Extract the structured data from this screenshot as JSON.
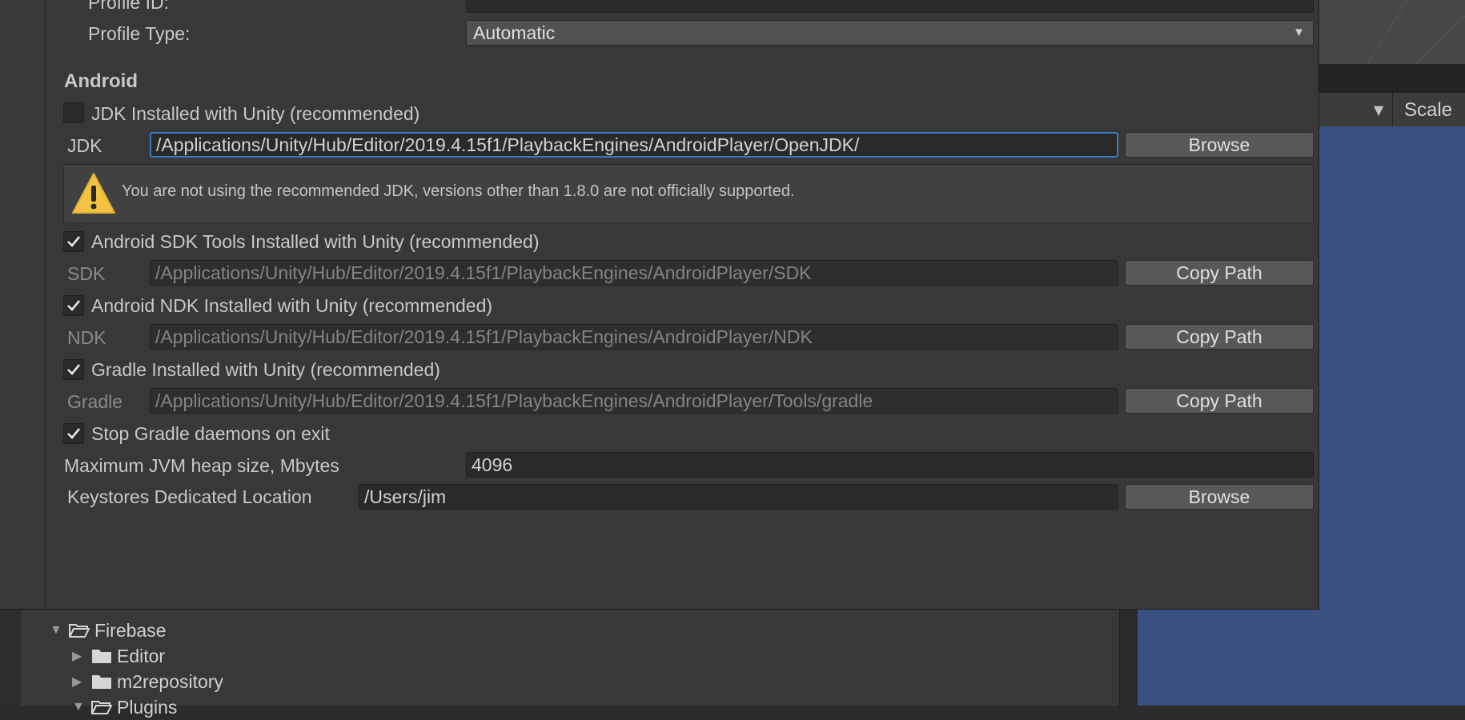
{
  "profile": {
    "id_label": "Profile ID:",
    "id_value": "",
    "type_label": "Profile Type:",
    "type_value": "Automatic"
  },
  "android": {
    "section_title": "Android",
    "jdk_checkbox": {
      "label": "JDK Installed with Unity (recommended)",
      "checked": false
    },
    "jdk": {
      "label": "JDK",
      "value": "/Applications/Unity/Hub/Editor/2019.4.15f1/PlaybackEngines/AndroidPlayer/OpenJDK/",
      "button": "Browse"
    },
    "warning": "You are not using the recommended JDK, versions other than 1.8.0 are not officially supported.",
    "sdk_checkbox": {
      "label": "Android SDK Tools Installed with Unity (recommended)",
      "checked": true
    },
    "sdk": {
      "label": "SDK",
      "value": "/Applications/Unity/Hub/Editor/2019.4.15f1/PlaybackEngines/AndroidPlayer/SDK",
      "button": "Copy Path"
    },
    "ndk_checkbox": {
      "label": "Android NDK Installed with Unity (recommended)",
      "checked": true
    },
    "ndk": {
      "label": "NDK",
      "value": "/Applications/Unity/Hub/Editor/2019.4.15f1/PlaybackEngines/AndroidPlayer/NDK",
      "button": "Copy Path"
    },
    "gradle_checkbox": {
      "label": "Gradle Installed with Unity (recommended)",
      "checked": true
    },
    "gradle": {
      "label": "Gradle",
      "value": "/Applications/Unity/Hub/Editor/2019.4.15f1/PlaybackEngines/AndroidPlayer/Tools/gradle",
      "button": "Copy Path"
    },
    "stop_gradle_checkbox": {
      "label": "Stop Gradle daemons on exit",
      "checked": true
    },
    "jvm_heap": {
      "label": "Maximum JVM heap size, Mbytes",
      "value": "4096"
    },
    "keystores": {
      "label": "Keystores Dedicated Location",
      "value": "/Users/jim",
      "button": "Browse"
    }
  },
  "background": {
    "toolbar_scale_label": "Scale",
    "project_tree": [
      "Firebase",
      "Editor",
      "m2repository",
      "Plugins"
    ]
  },
  "icons": {
    "checkmark": "checkmark-icon",
    "warning": "warning-icon",
    "folder": "folder-icon",
    "dropdown": "chevron-down-icon"
  },
  "colors": {
    "window_bg": "#383838",
    "field_bg": "#2a2a2a",
    "focus_border": "#3a79bb",
    "warning_yellow": "#f3c343",
    "game_view": "#3a5080"
  }
}
